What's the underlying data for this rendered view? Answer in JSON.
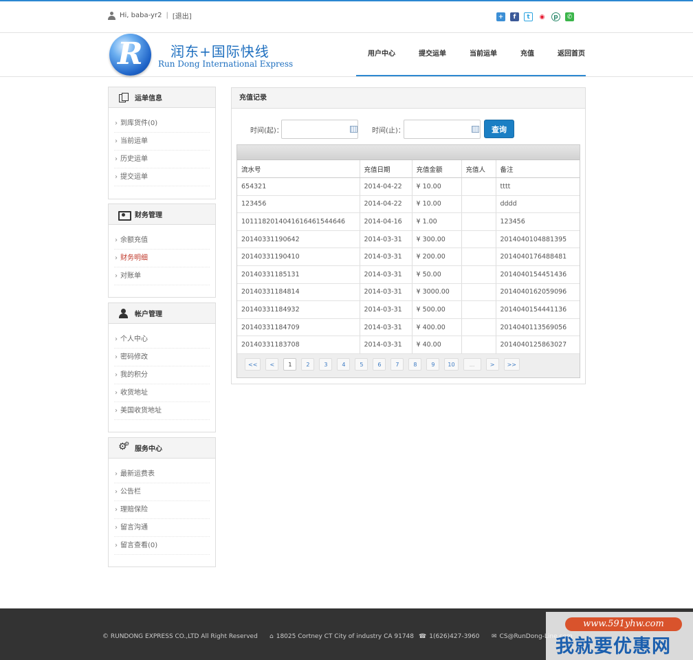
{
  "topbar": {
    "greeting": "Hi, baba-yr2",
    "separator": "|",
    "logout": "[退出]"
  },
  "logo": {
    "letter": "R",
    "cn": "润东+国际快线",
    "en": "Run Dong International Express"
  },
  "nav": [
    "用户中心",
    "提交运单",
    "当前运单",
    "充值",
    "返回首页"
  ],
  "sidebar": [
    {
      "title": "运单信息",
      "icon": "document-icon",
      "items": [
        "到库货件(0)",
        "当前运单",
        "历史运单",
        "提交运单"
      ]
    },
    {
      "title": "财务管理",
      "icon": "money-icon",
      "items": [
        "余额充值",
        "财务明细",
        "对账单"
      ],
      "active": "财务明细"
    },
    {
      "title": "帐户管理",
      "icon": "user-icon",
      "items": [
        "个人中心",
        "密码修改",
        "我的积分",
        "收货地址",
        "美国收货地址"
      ]
    },
    {
      "title": "服务中心",
      "icon": "gear-icon",
      "items": [
        "最新运费表",
        "公告栏",
        "理赔保险",
        "留言沟通",
        "留言查看(0)"
      ]
    }
  ],
  "main": {
    "title": "充值记录",
    "filter": {
      "from_label": "时间(起)：",
      "to_label": "时间(止)：",
      "from_value": "",
      "to_value": "",
      "query_button": "查询"
    },
    "table": {
      "columns": [
        "流水号",
        "充值日期",
        "充值金额",
        "充值人",
        "备注"
      ],
      "rows": [
        [
          "654321",
          "2014-04-22",
          "¥ 10.00",
          "",
          "tttt"
        ],
        [
          "123456",
          "2014-04-22",
          "¥ 10.00",
          "",
          "dddd"
        ],
        [
          "10111820140416164615446­46",
          "2014-04-16",
          "¥ 1.00",
          "",
          "123456"
        ],
        [
          "20140331190642",
          "2014-03-31",
          "¥ 300.00",
          "",
          "2014040104881395"
        ],
        [
          "20140331190410",
          "2014-03-31",
          "¥ 200.00",
          "",
          "2014040176488481"
        ],
        [
          "20140331185131",
          "2014-03-31",
          "¥ 50.00",
          "",
          "2014040154451436"
        ],
        [
          "20140331184814",
          "2014-03-31",
          "¥ 3000.00",
          "",
          "2014040162059096"
        ],
        [
          "20140331184932",
          "2014-03-31",
          "¥ 500.00",
          "",
          "2014040154441136"
        ],
        [
          "20140331184709",
          "2014-03-31",
          "¥ 400.00",
          "",
          "2014040113569056"
        ],
        [
          "20140331183708",
          "2014-03-31",
          "¥ 40.00",
          "",
          "2014040125863027"
        ]
      ]
    },
    "pager": {
      "items": [
        "<<",
        "<",
        "1",
        "2",
        "3",
        "4",
        "5",
        "6",
        "7",
        "8",
        "9",
        "10",
        "...",
        ">",
        ">>"
      ],
      "current": "1"
    }
  },
  "footer": {
    "copyright": "© RUNDONG EXPRESS CO.,LTD All Right Reserved",
    "address": "18025 Cortney CT City of industry CA 91748",
    "phone": "1(626)427-3960",
    "email": "CS@RunDong-Line.com"
  },
  "watermark": {
    "url": "www.591yhw.com",
    "text": "我就要优惠网"
  }
}
